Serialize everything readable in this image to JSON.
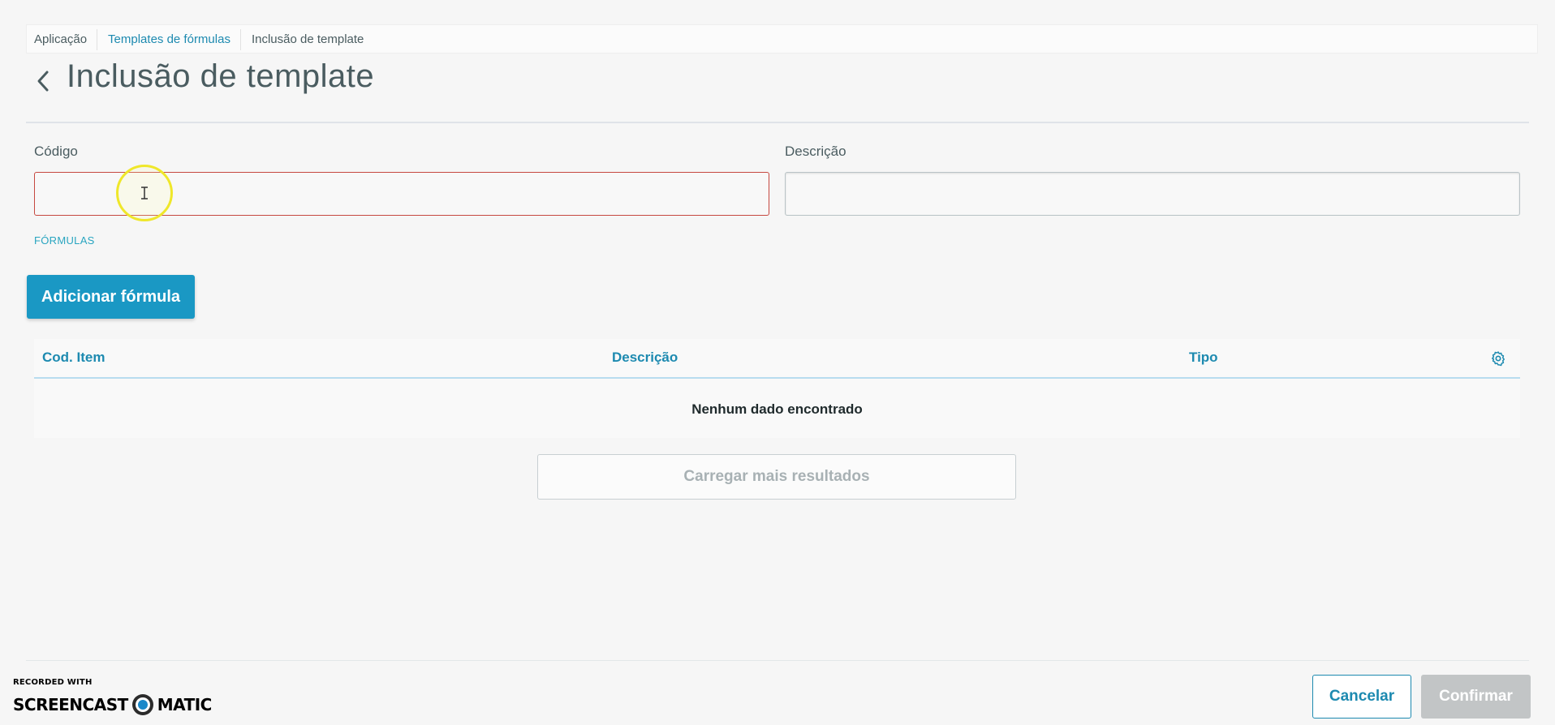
{
  "breadcrumb": {
    "items": [
      {
        "label": "Aplicação"
      },
      {
        "label": "Templates de fórmulas"
      },
      {
        "label": "Inclusão de template"
      }
    ]
  },
  "header": {
    "title": "Inclusão de template",
    "back_icon": "chevron-left-icon"
  },
  "form": {
    "codigo": {
      "label": "Código",
      "value": ""
    },
    "descricao": {
      "label": "Descrição",
      "value": ""
    }
  },
  "formulas": {
    "section_label": "FÓRMULAS",
    "add_button_label": "Adicionar fórmula",
    "table": {
      "columns": [
        "Cod. Item",
        "Descrição",
        "Tipo"
      ],
      "settings_icon": "gear-icon",
      "rows": [],
      "empty_message": "Nenhum dado encontrado"
    },
    "load_more_label": "Carregar mais resultados"
  },
  "footer": {
    "cancel_label": "Cancelar",
    "confirm_label": "Confirmar"
  },
  "watermark": {
    "line1": "RECORDED WITH",
    "line2_left": "SCREENCAST",
    "line2_right": "MATIC"
  },
  "colors": {
    "primary": "#1a98c4",
    "link": "#1d8ab0",
    "error_border": "#c64840",
    "disabled": "#c2c5c6",
    "cursor_highlight": "#efe72a"
  }
}
